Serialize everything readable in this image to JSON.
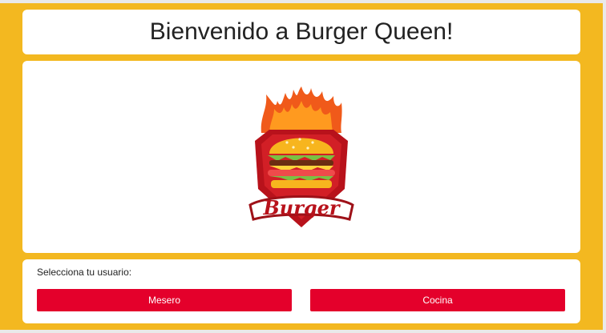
{
  "header": {
    "title": "Bienvenido a Burger Queen!"
  },
  "logo": {
    "name": "burger-logo-icon",
    "wordmark": "Burger"
  },
  "user_select": {
    "prompt": "Selecciona tu usuario:",
    "buttons": [
      {
        "label": "Mesero"
      },
      {
        "label": "Cocina"
      }
    ]
  },
  "colors": {
    "background": "#f3b820",
    "button": "#e4002b",
    "card": "#ffffff"
  }
}
